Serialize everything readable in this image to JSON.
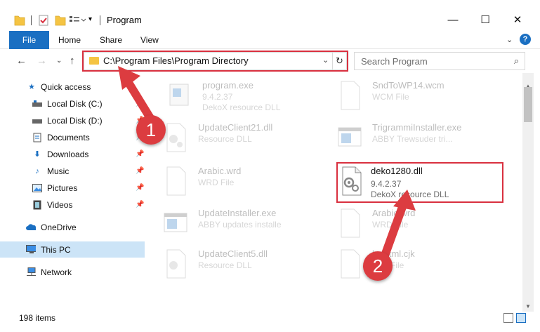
{
  "window": {
    "title": "Program",
    "controls": {
      "minimize": "—",
      "maximize": "☐",
      "close": "✕"
    }
  },
  "ribbon": {
    "tabs": [
      "File",
      "Home",
      "Share",
      "View"
    ],
    "help": "?"
  },
  "nav": {
    "address": "C:\\Program Files\\Program Directory",
    "search_placeholder": "Search Program"
  },
  "sidebar": {
    "items": [
      {
        "label": "Quick access",
        "icon": "star-icon",
        "pinned": false
      },
      {
        "label": "Local Disk (C:)",
        "icon": "drive-icon",
        "pinned": true
      },
      {
        "label": "Local Disk (D:)",
        "icon": "drive-icon",
        "pinned": true
      },
      {
        "label": "Documents",
        "icon": "documents-icon",
        "pinned": true
      },
      {
        "label": "Downloads",
        "icon": "download-icon",
        "pinned": true
      },
      {
        "label": "Music",
        "icon": "music-icon",
        "pinned": true
      },
      {
        "label": "Pictures",
        "icon": "pictures-icon",
        "pinned": true
      },
      {
        "label": "Videos",
        "icon": "video-icon",
        "pinned": true
      },
      {
        "label": "OneDrive",
        "icon": "cloud-icon",
        "pinned": false
      },
      {
        "label": "This PC",
        "icon": "computer-icon",
        "pinned": false,
        "selected": true
      },
      {
        "label": "Network",
        "icon": "network-icon",
        "pinned": false
      }
    ]
  },
  "files": [
    {
      "name": "program.exe",
      "line1": "9.4.2.37",
      "line2": "DekoX resource DLL",
      "icon": "exe-icon",
      "faded": true
    },
    {
      "name": "SndToWP14.wcm",
      "line1": "WCM File",
      "line2": "",
      "icon": "file-icon",
      "faded": true
    },
    {
      "name": "UpdateClient21.dll",
      "line1": "Resource DLL",
      "line2": "",
      "icon": "dll-icon",
      "faded": true
    },
    {
      "name": "TrigrammiInstaller.exe",
      "line1": "ABBY Trewsuder tri...",
      "line2": "",
      "icon": "app-window-icon",
      "faded": true
    },
    {
      "name": "Arabic.wrd",
      "line1": "WRD File",
      "line2": "",
      "icon": "file-icon",
      "faded": true
    },
    {
      "name": "deko1280.dll",
      "line1": "9.4.2.37",
      "line2": "DekoX resource DLL",
      "icon": "dll-icon",
      "faded": false
    },
    {
      "name": "UpdateInstaller.exe",
      "line1": "ABBY updates installe",
      "line2": "",
      "icon": "app-window-icon",
      "faded": true
    },
    {
      "name": "Arabic.wrd",
      "line1": "WRD File",
      "line2": "",
      "icon": "file-icon",
      "faded": true
    },
    {
      "name": "UpdateClient5.dll",
      "line1": "Resource DLL",
      "line2": "",
      "icon": "dll-icon",
      "faded": true
    },
    {
      "name": "ls_html.cjk",
      "line1": "CJK File",
      "line2": "",
      "icon": "file-icon",
      "faded": true
    }
  ],
  "status": {
    "item_count": "198 items"
  },
  "annotations": {
    "step1": "1",
    "step2": "2",
    "accent": "#dc3c40"
  }
}
